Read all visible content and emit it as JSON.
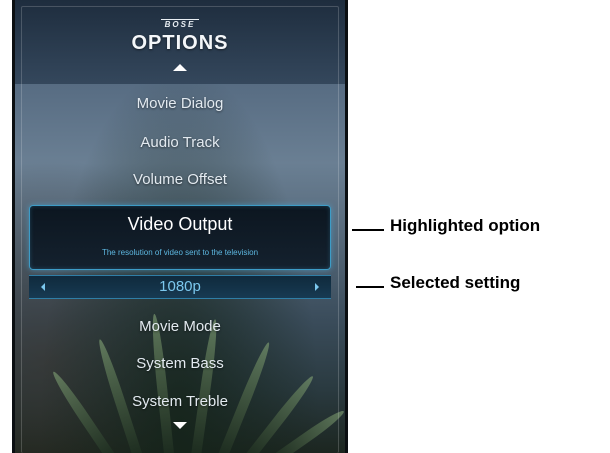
{
  "brand": "BOSE",
  "title": "OPTIONS",
  "menu_items": [
    {
      "label": "Movie Dialog"
    },
    {
      "label": "Audio Track"
    },
    {
      "label": "Volume Offset"
    }
  ],
  "highlighted": {
    "label": "Video Output",
    "description": "The resolution of video sent to the television"
  },
  "setting": {
    "value": "1080p"
  },
  "menu_items_below": [
    {
      "label": "Movie Mode"
    },
    {
      "label": "System Bass"
    },
    {
      "label": "System Treble"
    }
  ],
  "callouts": {
    "highlighted": "Highlighted option",
    "selected": "Selected setting"
  },
  "colors": {
    "highlight_border": "#3d9cc6",
    "setting_text": "#7cc8ee",
    "description_text": "#5db7e0"
  }
}
